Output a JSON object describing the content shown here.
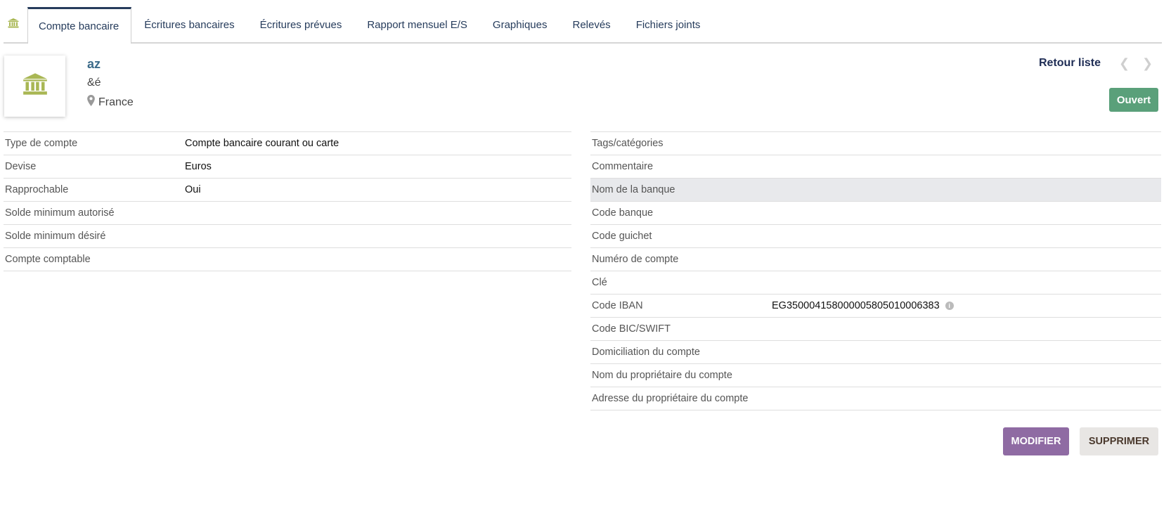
{
  "tabs": [
    {
      "label": "Compte bancaire"
    },
    {
      "label": "Écritures bancaires"
    },
    {
      "label": "Écritures prévues"
    },
    {
      "label": "Rapport mensuel E/S"
    },
    {
      "label": "Graphiques"
    },
    {
      "label": "Relevés"
    },
    {
      "label": "Fichiers joints"
    }
  ],
  "header": {
    "ref": "az",
    "label": "&é",
    "country": "France",
    "back_label": "Retour liste",
    "status": "Ouvert"
  },
  "left_fields": [
    {
      "label": "Type de compte",
      "value": "Compte bancaire courant ou carte"
    },
    {
      "label": "Devise",
      "value": "Euros"
    },
    {
      "label": "Rapprochable",
      "value": "Oui"
    },
    {
      "label": "Solde minimum autorisé",
      "value": ""
    },
    {
      "label": "Solde minimum désiré",
      "value": ""
    },
    {
      "label": "Compte comptable",
      "value": ""
    }
  ],
  "right_fields": [
    {
      "label": "Tags/catégories",
      "value": ""
    },
    {
      "label": "Commentaire",
      "value": ""
    },
    {
      "label": "Nom de la banque",
      "value": ""
    },
    {
      "label": "Code banque",
      "value": ""
    },
    {
      "label": "Code guichet",
      "value": ""
    },
    {
      "label": "Numéro de compte",
      "value": ""
    },
    {
      "label": "Clé",
      "value": ""
    },
    {
      "label": "Code IBAN",
      "value": "EG350004158000005805010006383"
    },
    {
      "label": "Code BIC/SWIFT",
      "value": ""
    },
    {
      "label": "Domiciliation du compte",
      "value": ""
    },
    {
      "label": "Nom du propriétaire du compte",
      "value": ""
    },
    {
      "label": "Adresse du propriétaire du compte",
      "value": ""
    }
  ],
  "actions": {
    "modify": "MODIFIER",
    "delete": "SUPPRIMER"
  },
  "icons": {
    "bank": "bank-icon",
    "location": "map-marker-icon",
    "info": "info-icon"
  },
  "colors": {
    "bank_icon": "#a9b754",
    "status_open": "#5aa07a",
    "modify_btn": "#8f6ba3",
    "tab_accent": "#263c5c"
  }
}
